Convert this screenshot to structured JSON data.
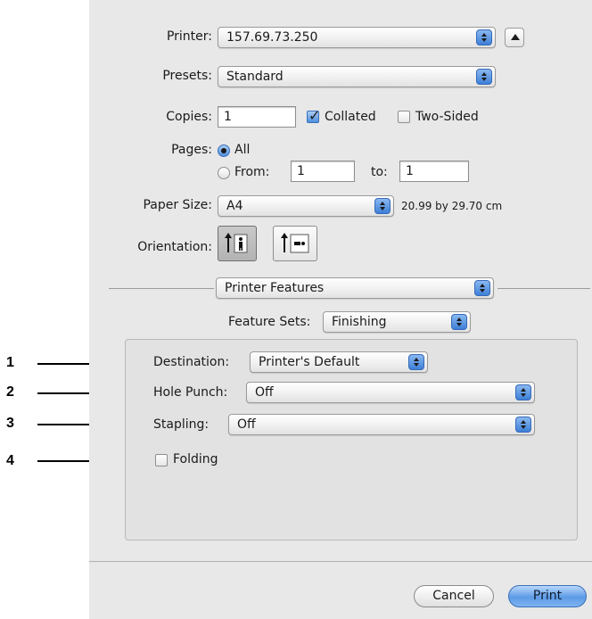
{
  "printer": {
    "label": "Printer:",
    "value": "157.69.73.250"
  },
  "presets": {
    "label": "Presets:",
    "value": "Standard"
  },
  "copies": {
    "label": "Copies:",
    "value": "1",
    "collated_label": "Collated",
    "collated_checked": true,
    "two_sided_label": "Two-Sided",
    "two_sided_checked": false
  },
  "pages": {
    "label": "Pages:",
    "all_label": "All",
    "from_label": "From:",
    "from_value": "1",
    "to_label": "to:",
    "to_value": "1",
    "selected": "All"
  },
  "paper_size": {
    "label": "Paper Size:",
    "value": "A4",
    "dimensions": "20.99 by 29.70 cm"
  },
  "orientation": {
    "label": "Orientation:",
    "options": [
      "portrait-icon",
      "landscape-icon"
    ],
    "selected": "portrait"
  },
  "panel": {
    "value": "Printer Features"
  },
  "feature_sets": {
    "label": "Feature Sets:",
    "value": "Finishing"
  },
  "finishing": {
    "destination": {
      "label": "Destination:",
      "value": "Printer's Default"
    },
    "hole_punch": {
      "label": "Hole Punch:",
      "value": "Off"
    },
    "stapling": {
      "label": "Stapling:",
      "value": "Off"
    },
    "folding": {
      "label": "Folding",
      "checked": false
    }
  },
  "buttons": {
    "cancel": "Cancel",
    "print": "Print"
  },
  "callouts": [
    "1",
    "2",
    "3",
    "4"
  ],
  "colors": {
    "accent": "#4f8fdc",
    "dialog_bg": "#e8e8e8",
    "group_bg": "#e2e2e2"
  }
}
